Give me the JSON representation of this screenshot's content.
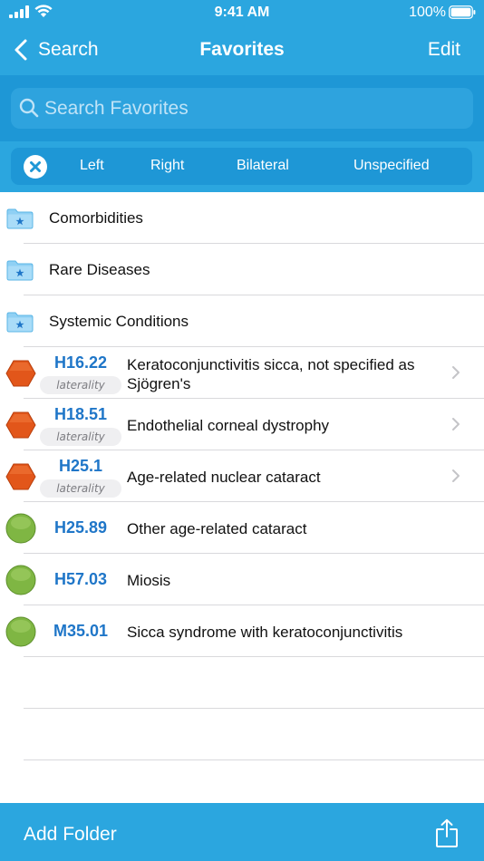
{
  "status_bar": {
    "time": "9:41 AM",
    "battery": "100%"
  },
  "nav": {
    "back_label": "Search",
    "title": "Favorites",
    "edit_label": "Edit"
  },
  "search": {
    "placeholder": "Search Favorites"
  },
  "laterality_filter": {
    "options": [
      "Left",
      "Right",
      "Bilateral",
      "Unspecified"
    ]
  },
  "folders": [
    {
      "label": "Comorbidities"
    },
    {
      "label": "Rare Diseases"
    },
    {
      "label": "Systemic Conditions"
    }
  ],
  "codes": [
    {
      "code": "H16.22",
      "description": "Keratoconjunctivitis sicca, not specified as Sjögren's",
      "status": "orange-hexagon",
      "chip": "laterality",
      "disclosure": true
    },
    {
      "code": "H18.51",
      "description": "Endothelial corneal dystrophy",
      "status": "orange-hexagon",
      "chip": "laterality",
      "disclosure": true
    },
    {
      "code": "H25.1",
      "description": "Age-related nuclear cataract",
      "status": "orange-hexagon",
      "chip": "laterality",
      "disclosure": true
    },
    {
      "code": "H25.89",
      "description": "Other age-related cataract",
      "status": "green-circle",
      "chip": "",
      "disclosure": false
    },
    {
      "code": "H57.03",
      "description": "Miosis",
      "status": "green-circle",
      "chip": "",
      "disclosure": false
    },
    {
      "code": "M35.01",
      "description": "Sicca syndrome with keratoconjunctivitis",
      "status": "green-circle",
      "chip": "",
      "disclosure": false
    }
  ],
  "toolbar": {
    "add_folder_label": "Add Folder",
    "share_icon": "share-icon"
  },
  "colors": {
    "header_blue": "#2ba6df",
    "search_blue": "#1e97d6",
    "code_blue": "#1f76c8",
    "warning_orange": "#e2561a",
    "ok_green": "#7fb643"
  }
}
